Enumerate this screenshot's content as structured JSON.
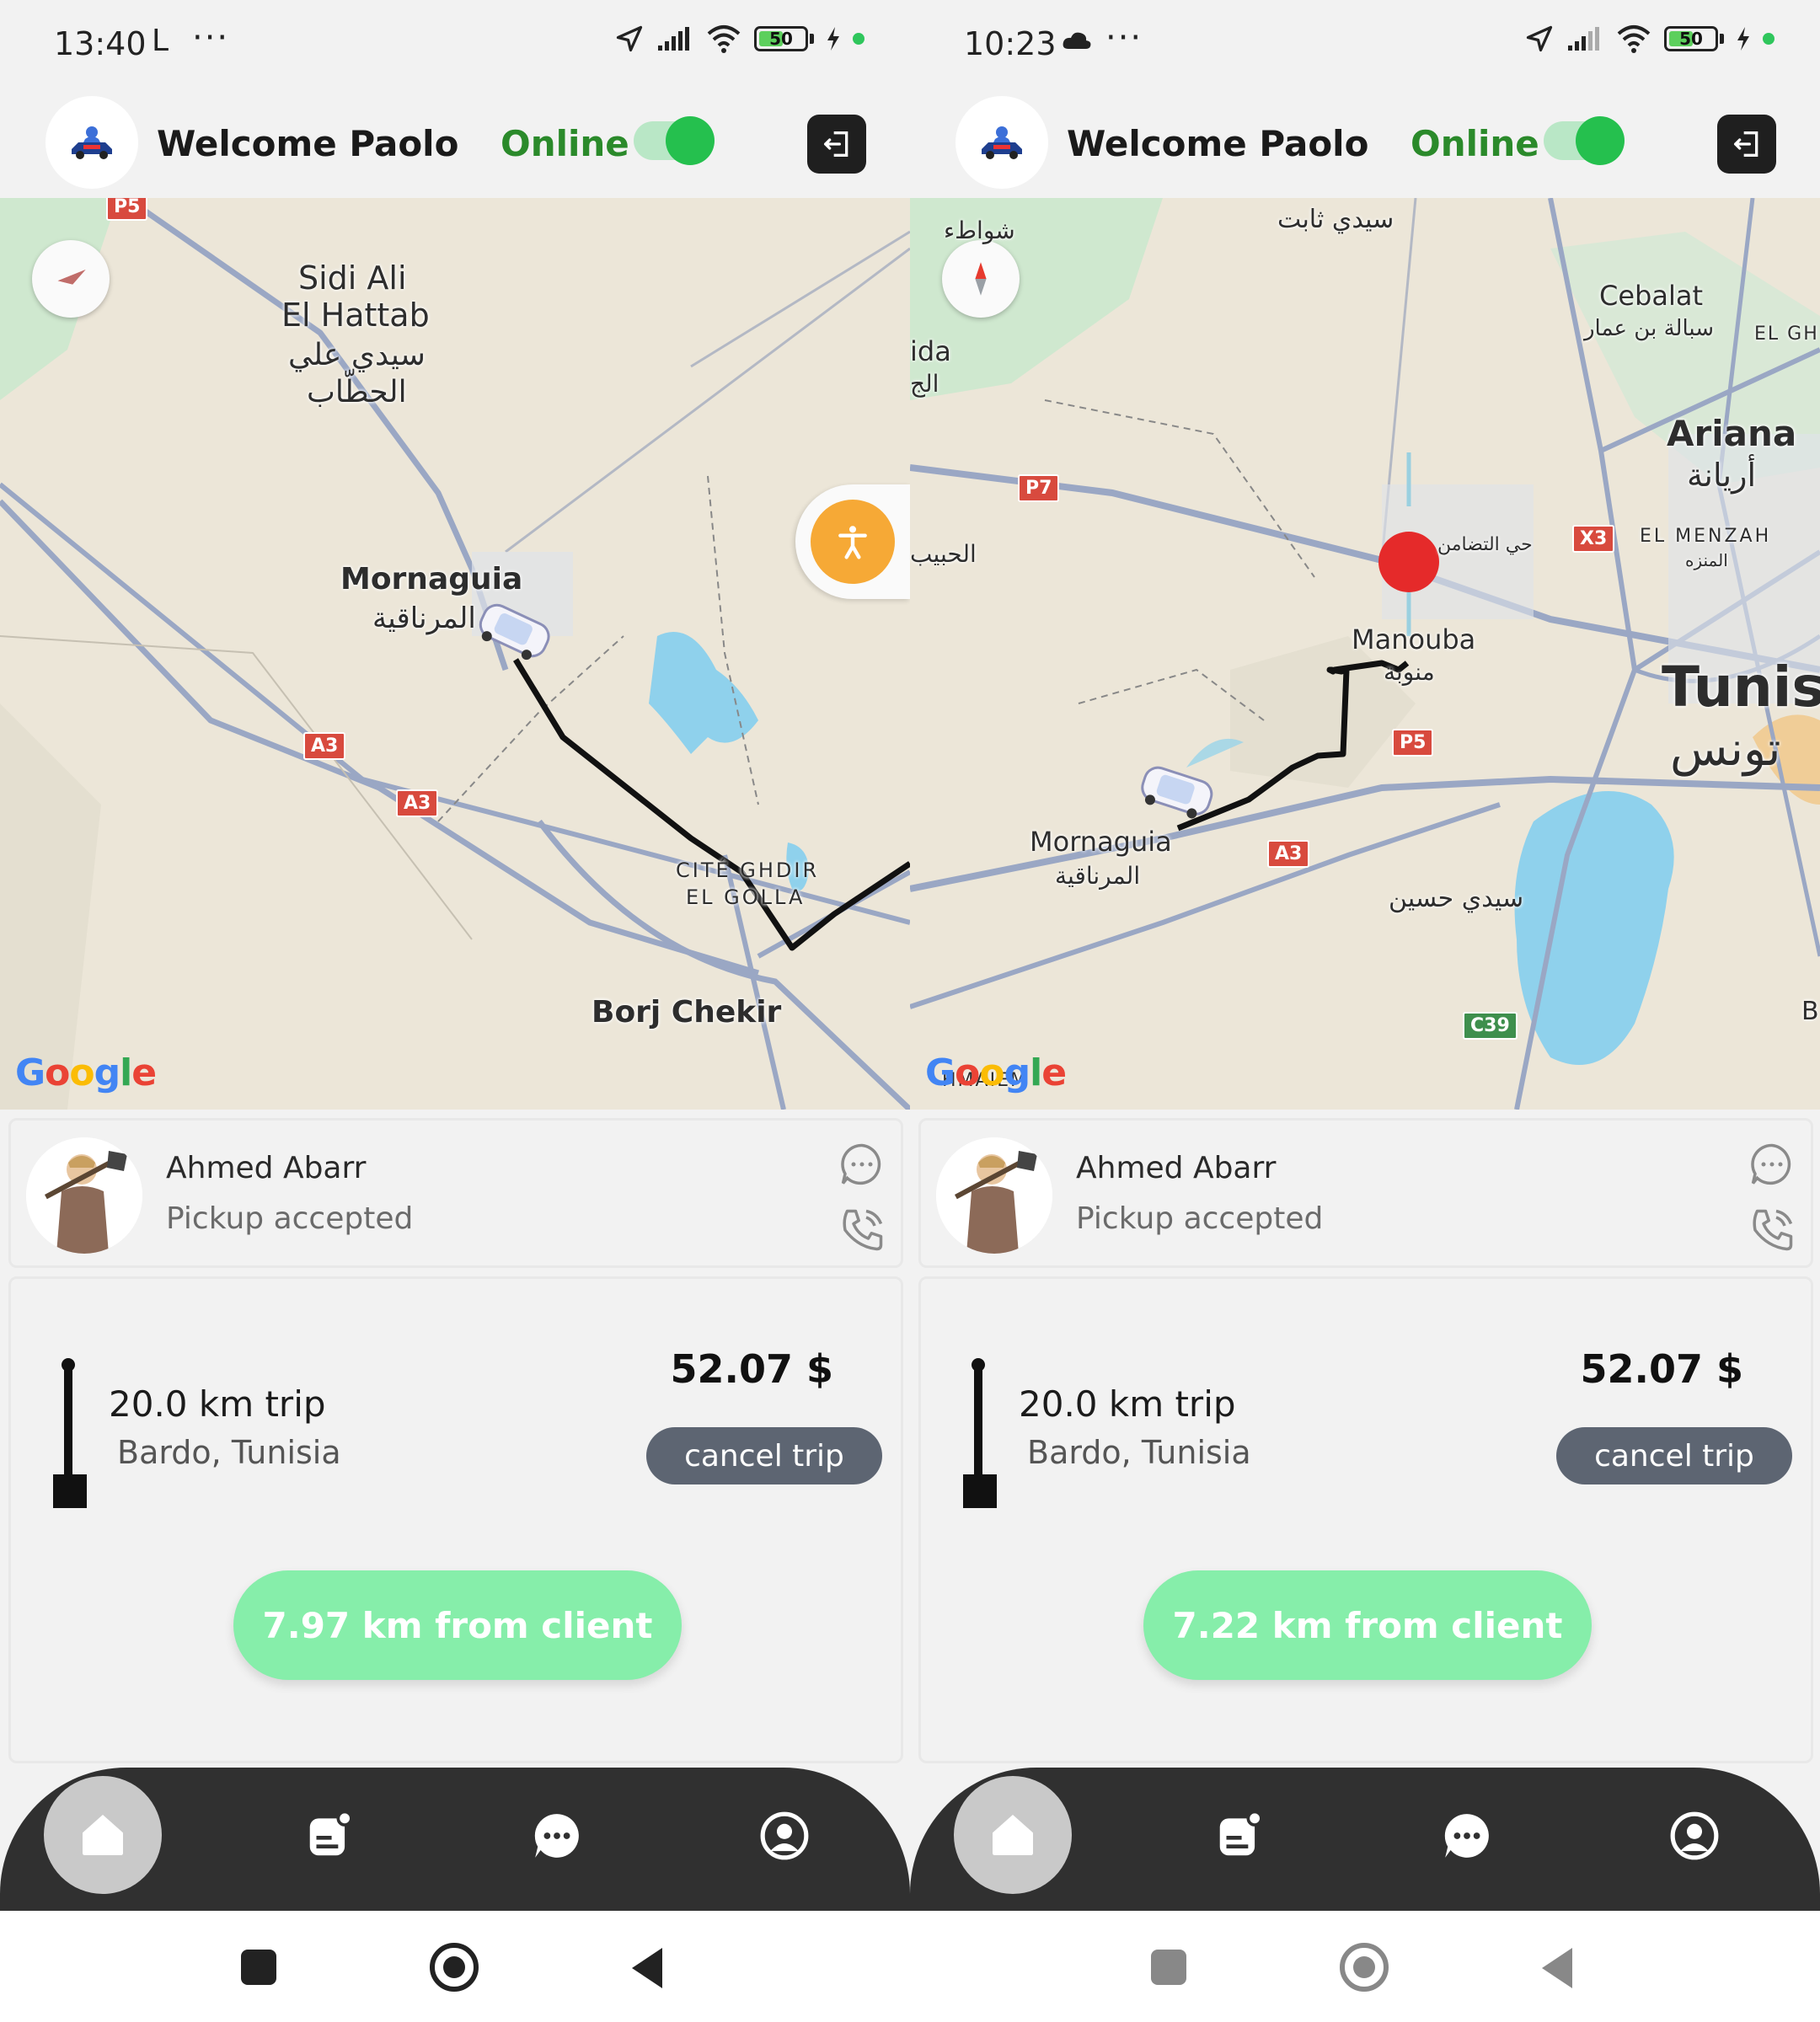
{
  "screens": [
    {
      "status": {
        "time": "13:40",
        "extra_glyph": "L",
        "dots": "···",
        "battery": "50"
      },
      "header": {
        "welcome": "Welcome Paolo",
        "online": "Online"
      },
      "map": {
        "labels": {
          "sidi_ali": "Sidi Ali",
          "el_hattab": "El Hattab",
          "sidi_ali_ar": "سيدي علي",
          "hattab_ar": "الحطّاب",
          "mornaguia": "Mornaguia",
          "mornaguia_ar": "المرناقية",
          "cite_ghdir": "CITÉ GHDIR",
          "el_golla": "EL GOLLA",
          "borj_chekir": "Borj Chekir"
        },
        "badges": {
          "p5": "P5",
          "a3a": "A3",
          "a3b": "A3"
        },
        "google": [
          "G",
          "o",
          "o",
          "g",
          "l",
          "e"
        ]
      },
      "client": {
        "name": "Ahmed Abarr",
        "status": "Pickup accepted"
      },
      "trip": {
        "km": "20.0 km trip",
        "address": "Bardo, Tunisia",
        "price": "52.07 $",
        "cancel": "cancel trip",
        "distance": "7.97 km from client"
      }
    },
    {
      "status": {
        "time": "10:23",
        "dots": "···",
        "battery": "50"
      },
      "header": {
        "welcome": "Welcome Paolo",
        "online": "Online"
      },
      "map": {
        "labels": {
          "sidi_thabet_ar": "سيدي ثابت",
          "sawahel_ar": "شواطء",
          "ida": "ida",
          "jid_ar": "الج",
          "habib_ar": "الحبيب",
          "cebalat": "Cebalat",
          "cebalat_ar": "سبالة بن عمار",
          "el_gh": "EL GH",
          "ariana": "Ariana",
          "ariana_ar": "أريانة",
          "tadamon_ar": "حي التضامن",
          "el_menzah": "EL MENZAH",
          "menzah_ar": "المنزه",
          "manouba": "Manouba",
          "manouba_ar": "منوبة",
          "tunis": "Tunis",
          "tunis_ar": "تونس",
          "mornaguia": "Mornaguia",
          "mornaguia_ar": "المرناقية",
          "sidi_hassine_ar": "سيدي حسين",
          "hmaiem": "HMAIEM",
          "b": "B"
        },
        "badges": {
          "p7": "P7",
          "x3": "X3",
          "p5": "P5",
          "a3": "A3",
          "c39": "C39"
        },
        "google": [
          "G",
          "o",
          "o",
          "g",
          "l",
          "e"
        ]
      },
      "client": {
        "name": "Ahmed Abarr",
        "status": "Pickup accepted"
      },
      "trip": {
        "km": "20.0 km trip",
        "address": "Bardo, Tunisia",
        "price": "52.07 $",
        "cancel": "cancel trip",
        "distance": "7.22 km from client"
      }
    }
  ],
  "icons": {
    "logo": "car-logo-icon",
    "logout": "logout-icon",
    "compass": "compass-icon",
    "accessibility": "accessibility-icon",
    "chat": "chat-bubble-icon",
    "phone": "phone-icon",
    "nav": [
      "home-icon",
      "orders-icon",
      "messages-icon",
      "profile-icon"
    ]
  },
  "colors": {
    "online_green": "#2b8a2b",
    "toggle_knob": "#25c04e",
    "distance_button": "#86eeaa",
    "cancel_button": "#5d6572",
    "nav_bar": "#303030",
    "route": "#000000",
    "pin": "#e52a2a"
  }
}
